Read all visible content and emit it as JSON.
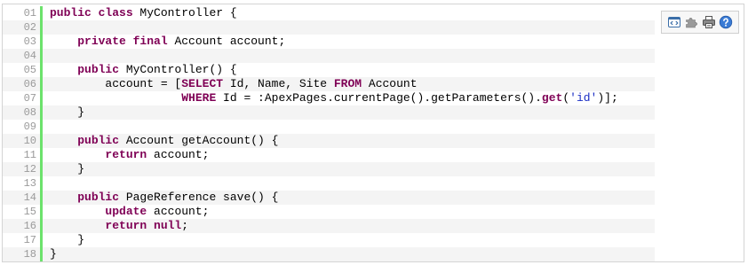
{
  "colors": {
    "keyword": "#7f0055",
    "string": "#1b2ec4",
    "line_number": "#9a9a9a",
    "gutter_bar": "#6ce26c",
    "alt_row": "#f4f4f4",
    "border": "#d4d4d4"
  },
  "toolbar": {
    "icons": [
      "view-source-icon",
      "puzzle-icon",
      "print-icon",
      "help-icon"
    ]
  },
  "code": {
    "lines": [
      {
        "num": "01",
        "segments": [
          {
            "text": "public class",
            "kind": "kw"
          },
          {
            "text": " MyController {",
            "kind": "plain"
          }
        ]
      },
      {
        "num": "02",
        "segments": []
      },
      {
        "num": "03",
        "segments": [
          {
            "text": "    ",
            "kind": "plain"
          },
          {
            "text": "private final",
            "kind": "kw"
          },
          {
            "text": " Account account;",
            "kind": "plain"
          }
        ]
      },
      {
        "num": "04",
        "segments": []
      },
      {
        "num": "05",
        "segments": [
          {
            "text": "    ",
            "kind": "plain"
          },
          {
            "text": "public",
            "kind": "kw"
          },
          {
            "text": " MyController() {",
            "kind": "plain"
          }
        ]
      },
      {
        "num": "06",
        "segments": [
          {
            "text": "        account = [",
            "kind": "plain"
          },
          {
            "text": "SELECT",
            "kind": "kw"
          },
          {
            "text": " Id, Name, Site ",
            "kind": "plain"
          },
          {
            "text": "FROM",
            "kind": "kw"
          },
          {
            "text": " Account",
            "kind": "plain"
          }
        ]
      },
      {
        "num": "07",
        "segments": [
          {
            "text": "                   ",
            "kind": "plain"
          },
          {
            "text": "WHERE",
            "kind": "kw"
          },
          {
            "text": " Id = :ApexPages.currentPage().getParameters().",
            "kind": "plain"
          },
          {
            "text": "get",
            "kind": "kw"
          },
          {
            "text": "(",
            "kind": "plain"
          },
          {
            "text": "'id'",
            "kind": "str"
          },
          {
            "text": ")];",
            "kind": "plain"
          }
        ]
      },
      {
        "num": "08",
        "segments": [
          {
            "text": "    }",
            "kind": "plain"
          }
        ]
      },
      {
        "num": "09",
        "segments": []
      },
      {
        "num": "10",
        "segments": [
          {
            "text": "    ",
            "kind": "plain"
          },
          {
            "text": "public",
            "kind": "kw"
          },
          {
            "text": " Account getAccount() {",
            "kind": "plain"
          }
        ]
      },
      {
        "num": "11",
        "segments": [
          {
            "text": "        ",
            "kind": "plain"
          },
          {
            "text": "return",
            "kind": "kw"
          },
          {
            "text": " account;",
            "kind": "plain"
          }
        ]
      },
      {
        "num": "12",
        "segments": [
          {
            "text": "    }",
            "kind": "plain"
          }
        ]
      },
      {
        "num": "13",
        "segments": []
      },
      {
        "num": "14",
        "segments": [
          {
            "text": "    ",
            "kind": "plain"
          },
          {
            "text": "public",
            "kind": "kw"
          },
          {
            "text": " PageReference save() {",
            "kind": "plain"
          }
        ]
      },
      {
        "num": "15",
        "segments": [
          {
            "text": "        ",
            "kind": "plain"
          },
          {
            "text": "update",
            "kind": "kw"
          },
          {
            "text": " account;",
            "kind": "plain"
          }
        ]
      },
      {
        "num": "16",
        "segments": [
          {
            "text": "        ",
            "kind": "plain"
          },
          {
            "text": "return null",
            "kind": "kw"
          },
          {
            "text": ";",
            "kind": "plain"
          }
        ]
      },
      {
        "num": "17",
        "segments": [
          {
            "text": "    }",
            "kind": "plain"
          }
        ]
      },
      {
        "num": "18",
        "segments": [
          {
            "text": "}",
            "kind": "plain"
          }
        ]
      }
    ]
  }
}
